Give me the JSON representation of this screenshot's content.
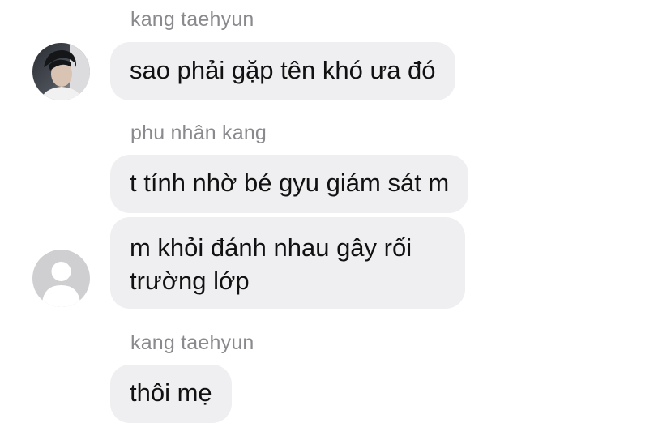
{
  "conversation": {
    "groups": [
      {
        "sender": "kang taehyun",
        "messages": [
          "sao phải gặp tên khó ưa đó"
        ]
      },
      {
        "sender": "phu nhân kang",
        "messages": [
          "t tính nhờ bé gyu giám sát m",
          "m khỏi đánh nhau gây rối",
          "trường lớp"
        ]
      },
      {
        "sender": "kang taehyun",
        "messages": [
          "thôi mẹ"
        ]
      }
    ]
  },
  "colors": {
    "bubble_bg": "#efeff1",
    "sender_text": "#8a8a8e",
    "message_text": "#111111",
    "default_avatar_bg": "#cfcfd1"
  },
  "icons": {
    "avatar_1": "user-photo-avatar",
    "avatar_2": "default-user-avatar"
  }
}
